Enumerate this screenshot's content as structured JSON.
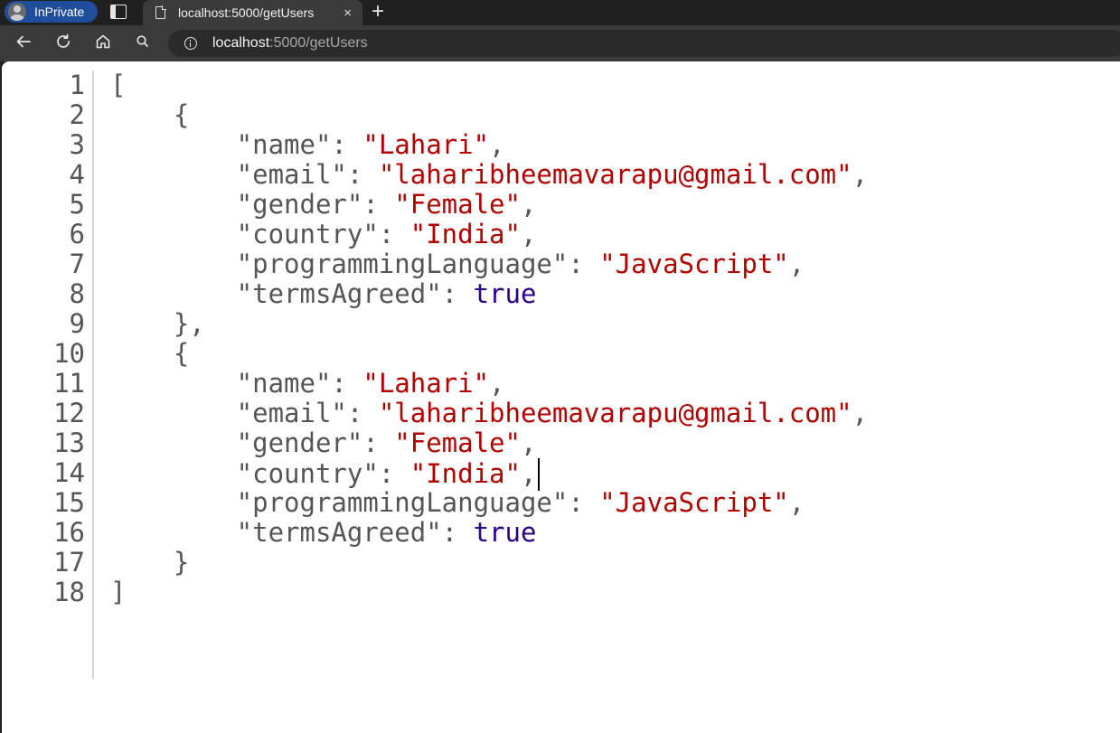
{
  "browser": {
    "inprivate_label": "InPrivate",
    "tab_title": "localhost:5000/getUsers",
    "tab_close_glyph": "×",
    "new_tab_glyph": "+",
    "url_host": "localhost",
    "url_rest": ":5000/getUsers",
    "accent_color": "#1f4f9c"
  },
  "icons": {
    "back": "back-arrow-icon",
    "refresh": "refresh-icon",
    "home": "home-icon",
    "search": "search-icon",
    "info": "info-icon"
  },
  "colors": {
    "string": "#b00000",
    "boolean": "#2a0088",
    "punctuation": "#555555"
  },
  "json_view": {
    "lines": [
      {
        "n": "1",
        "segs": [
          {
            "t": "[",
            "c": "p"
          }
        ]
      },
      {
        "n": "2",
        "segs": [
          {
            "t": "    {",
            "c": "p"
          }
        ]
      },
      {
        "n": "3",
        "segs": [
          {
            "t": "        \"name\": ",
            "c": "p"
          },
          {
            "t": "\"Lahari\"",
            "c": "s"
          },
          {
            "t": ",",
            "c": "p"
          }
        ]
      },
      {
        "n": "4",
        "segs": [
          {
            "t": "        \"email\": ",
            "c": "p"
          },
          {
            "t": "\"laharibheemavarapu@gmail.com\"",
            "c": "s"
          },
          {
            "t": ",",
            "c": "p"
          }
        ]
      },
      {
        "n": "5",
        "segs": [
          {
            "t": "        \"gender\": ",
            "c": "p"
          },
          {
            "t": "\"Female\"",
            "c": "s"
          },
          {
            "t": ",",
            "c": "p"
          }
        ]
      },
      {
        "n": "6",
        "segs": [
          {
            "t": "        \"country\": ",
            "c": "p"
          },
          {
            "t": "\"India\"",
            "c": "s"
          },
          {
            "t": ",",
            "c": "p"
          }
        ]
      },
      {
        "n": "7",
        "segs": [
          {
            "t": "        \"programmingLanguage\": ",
            "c": "p"
          },
          {
            "t": "\"JavaScript\"",
            "c": "s"
          },
          {
            "t": ",",
            "c": "p"
          }
        ]
      },
      {
        "n": "8",
        "segs": [
          {
            "t": "        \"termsAgreed\": ",
            "c": "p"
          },
          {
            "t": "true",
            "c": "b"
          }
        ]
      },
      {
        "n": "9",
        "segs": [
          {
            "t": "    },",
            "c": "p"
          }
        ]
      },
      {
        "n": "10",
        "segs": [
          {
            "t": "    {",
            "c": "p"
          }
        ]
      },
      {
        "n": "11",
        "segs": [
          {
            "t": "        \"name\": ",
            "c": "p"
          },
          {
            "t": "\"Lahari\"",
            "c": "s"
          },
          {
            "t": ",",
            "c": "p"
          }
        ]
      },
      {
        "n": "12",
        "segs": [
          {
            "t": "        \"email\": ",
            "c": "p"
          },
          {
            "t": "\"laharibheemavarapu@gmail.com\"",
            "c": "s"
          },
          {
            "t": ",",
            "c": "p"
          }
        ]
      },
      {
        "n": "13",
        "segs": [
          {
            "t": "        \"gender\": ",
            "c": "p"
          },
          {
            "t": "\"Female\"",
            "c": "s"
          },
          {
            "t": ",",
            "c": "p"
          }
        ]
      },
      {
        "n": "14",
        "segs": [
          {
            "t": "        \"country\": ",
            "c": "p"
          },
          {
            "t": "\"India\"",
            "c": "s"
          },
          {
            "t": ",",
            "c": "p"
          }
        ],
        "caret": true
      },
      {
        "n": "15",
        "segs": [
          {
            "t": "        \"programmingLanguage\": ",
            "c": "p"
          },
          {
            "t": "\"JavaScript\"",
            "c": "s"
          },
          {
            "t": ",",
            "c": "p"
          }
        ]
      },
      {
        "n": "16",
        "segs": [
          {
            "t": "        \"termsAgreed\": ",
            "c": "p"
          },
          {
            "t": "true",
            "c": "b"
          }
        ]
      },
      {
        "n": "17",
        "segs": [
          {
            "t": "    }",
            "c": "p"
          }
        ]
      },
      {
        "n": "18",
        "segs": [
          {
            "t": "]",
            "c": "p"
          }
        ]
      }
    ]
  }
}
